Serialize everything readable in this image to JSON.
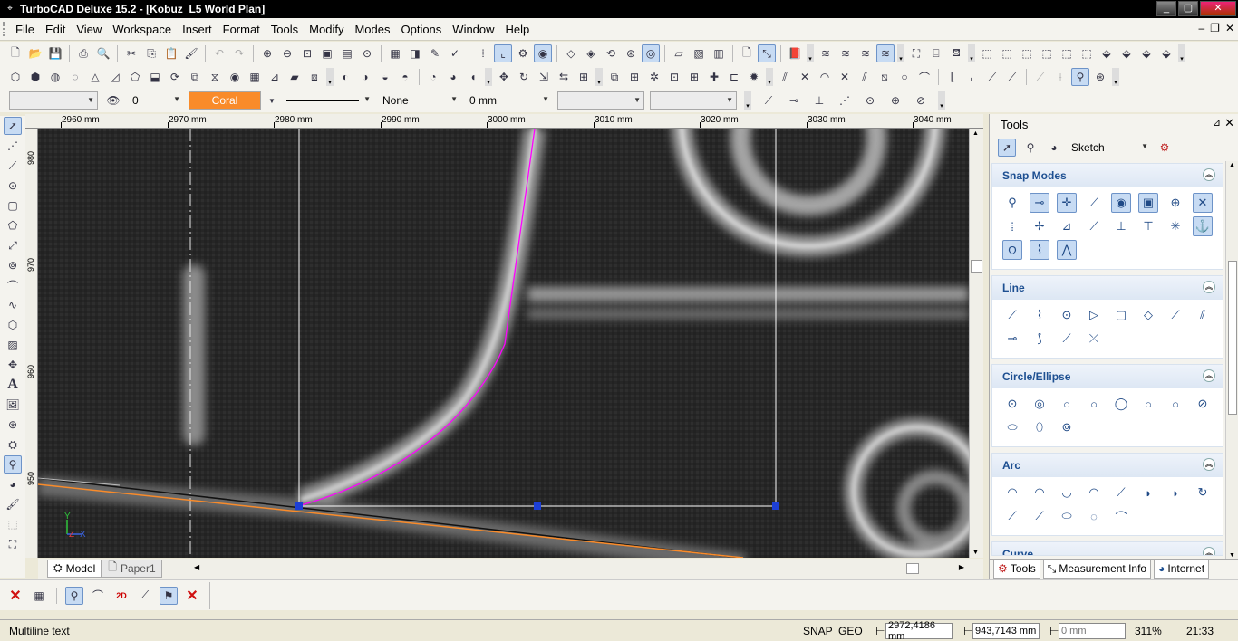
{
  "window": {
    "title": "TurboCAD Deluxe 15.2 - [Kobuz_L5 World Plan]",
    "app_icon": "turbocad-logo-icon",
    "minimize": "_",
    "maximize": "▢",
    "close": "✕"
  },
  "menu": {
    "items": [
      "File",
      "Edit",
      "View",
      "Workspace",
      "Insert",
      "Format",
      "Tools",
      "Modify",
      "Modes",
      "Options",
      "Window",
      "Help"
    ],
    "mdi_minimize": "–",
    "mdi_restore": "❐",
    "mdi_close": "✕"
  },
  "propbar": {
    "layer_value": "",
    "visibility_value": "0",
    "color_value": "Coral",
    "color_hex": "#f98b2a",
    "pattern_value": "None",
    "width_value": "0 mm",
    "style_a_value": "",
    "style_b_value": ""
  },
  "ruler": {
    "h_labels": [
      "2960 mm",
      "2970 mm",
      "2980 mm",
      "2990 mm",
      "3000 mm",
      "3010 mm",
      "3020 mm",
      "3030 mm",
      "3040 mm"
    ],
    "v_labels": [
      "980 mm",
      "970 mm",
      "960 mm",
      "950 mm"
    ]
  },
  "canvas": {
    "axis_y": "Y",
    "axis_z": "Z",
    "axis_x": "X",
    "selection_line_color": "#ffffff",
    "curve_color": "#ff00ff",
    "orange_line_color": "#f98b2a"
  },
  "tabs": {
    "model": "Model",
    "paper": "Paper1"
  },
  "statusbar": {
    "message": "Multiline text",
    "snap": "SNAP",
    "geo": "GEO",
    "x_value": "2972,4186 mm",
    "y_value": "943,7143 mm",
    "z_placeholder": "0 mm",
    "zoom": "311%",
    "time": "21:33"
  },
  "rightpanel": {
    "title": "Tools",
    "pin": "⊿",
    "close": "✕",
    "mode_value": "Sketch",
    "sections": [
      {
        "title": "Snap Modes",
        "icons": [
          "snap-vertex",
          "snap-middle",
          "snap-center",
          "snap-quadrant",
          "snap-tangent",
          "snap-grid",
          "snap-intersection",
          "snap-perpendicular",
          "snap-nearest",
          "snap-on-graphic",
          "snap-relative",
          "snap-align-x",
          "snap-align-y",
          "snap-angle",
          "snap-absolute",
          "snap-magnetic",
          "snap-tooltip",
          "snap-apex"
        ]
      },
      {
        "title": "Line",
        "icons": [
          "single-line",
          "polyline",
          "double-line",
          "parallel-line",
          "rectangle",
          "rotated-rectangle",
          "perpendicular-line",
          "tangent-line",
          "angle-line",
          "bisector-line",
          "tangent-arc-line",
          "curve-line"
        ]
      },
      {
        "title": "Circle/Ellipse",
        "icons": [
          "circle-center",
          "concentric-circle",
          "circle-diameter",
          "circle-3pt",
          "circle-tangent-arc",
          "circle-tangent-line",
          "circle-tangent-3",
          "circle-2tangent",
          "ellipse",
          "rotated-ellipse",
          "ellipse-3pt"
        ]
      },
      {
        "title": "Arc",
        "icons": [
          "arc-center",
          "arc-concentric",
          "arc-2pt",
          "arc-3pt",
          "arc-tangent",
          "arc-tangent-2",
          "arc-double",
          "arc-3tangent",
          "arc-elliptical",
          "arc-rotated",
          "arc-partial",
          "arc-free"
        ]
      },
      {
        "title": "Curve",
        "icons": []
      }
    ],
    "bottom_tabs": [
      "Tools",
      "Measurement Info",
      "Internet"
    ]
  }
}
